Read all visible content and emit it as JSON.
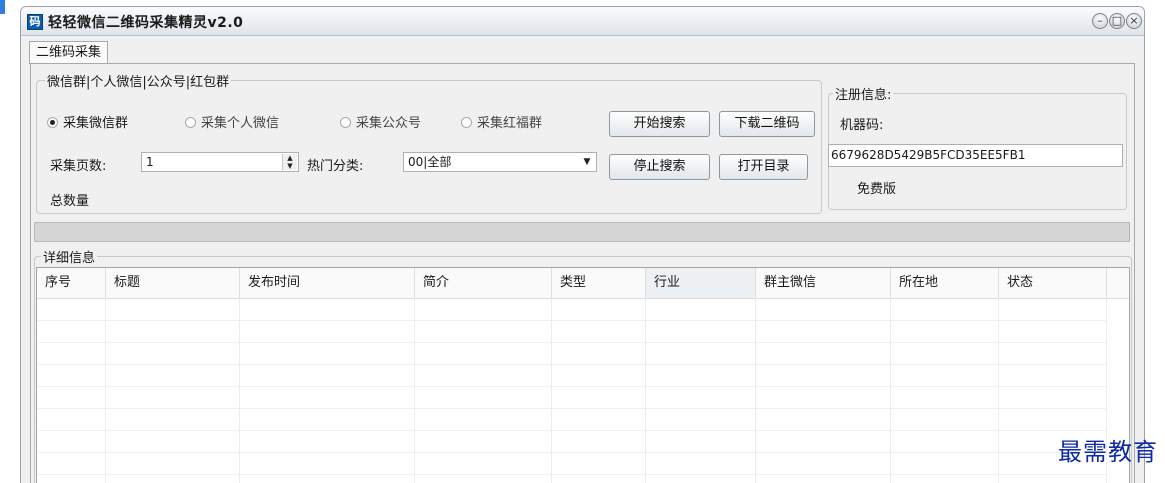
{
  "window": {
    "title": "轻轻微信二维码采集精灵v2.0",
    "app_icon_glyph": "码",
    "icons": {
      "app": "qr-app-icon",
      "minimize": "minimize-icon",
      "maximize": "maximize-icon",
      "close": "close-icon"
    }
  },
  "tabs": [
    {
      "label": "二维码采集",
      "active": true
    }
  ],
  "search_group": {
    "legend": "微信群|个人微信|公众号|红包群",
    "radios": [
      {
        "label": "采集微信群",
        "checked": true
      },
      {
        "label": "采集个人微信",
        "checked": false
      },
      {
        "label": "采集公众号",
        "checked": false
      },
      {
        "label": "采集红福群",
        "checked": false
      }
    ],
    "pages_label": "采集页数:",
    "pages_value": "1",
    "category_label": "热门分类:",
    "category_value": "00|全部",
    "total_label": "总数量",
    "buttons": {
      "start_search": "开始搜索",
      "download_qr": "下载二维码",
      "stop_search": "停止搜索",
      "open_folder": "打开目录"
    }
  },
  "register_group": {
    "legend": "注册信息:",
    "machine_code_label": "机器码:",
    "machine_code": "6679628D5429B5FCD35EE5FB1",
    "edition": "免费版"
  },
  "progress": {
    "value": 0
  },
  "details": {
    "legend": "详细信息",
    "columns": [
      "序号",
      "标题",
      "发布时间",
      "简介",
      "类型",
      "行业",
      "群主微信",
      "所在地",
      "状态"
    ],
    "rows": []
  },
  "watermark": "最需教育",
  "colors": {
    "progress_fill": "#3da64a",
    "watermark": "#0d2aa8",
    "title_gradient_bottom": "#dfe4ea"
  }
}
